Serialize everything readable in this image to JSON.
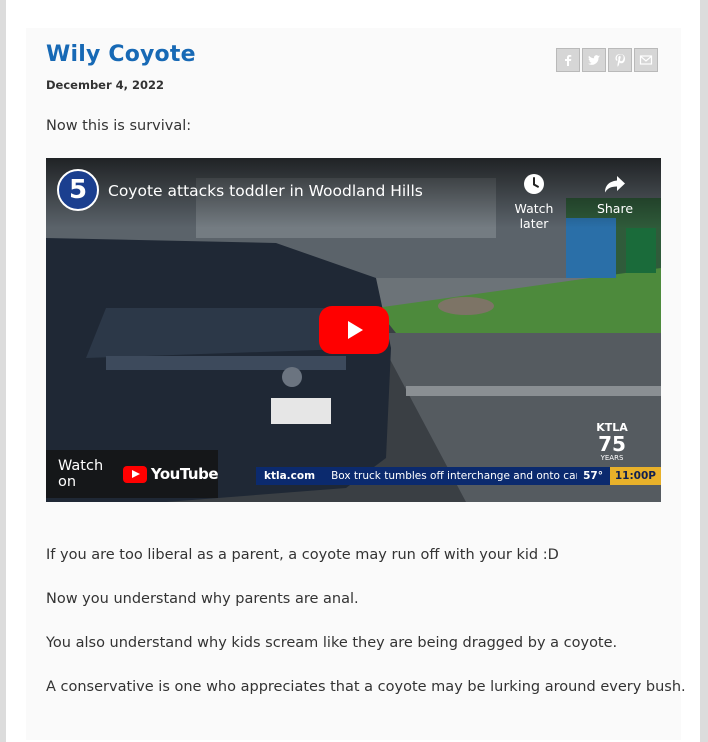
{
  "post": {
    "title": "Wily Coyote",
    "date": "December 4, 2022",
    "intro": "Now this is survival:",
    "paragraphs": [
      "If you are too liberal as a parent, a coyote may run off with your kid :D",
      "Now you understand why parents are anal.",
      "You also understand why kids scream like they are being dragged by a coyote.",
      "A conservative is one who appreciates that a coyote may be lurking around every bush."
    ]
  },
  "share": {
    "icons": [
      "facebook-icon",
      "twitter-icon",
      "pinterest-icon",
      "email-icon"
    ]
  },
  "video": {
    "channel_logo_text": "5",
    "title": "Coyote attacks toddler in Woodland Hills",
    "watch_later_label": "Watch later",
    "share_label": "Share",
    "watch_on_label": "Watch on",
    "youtube_label": "YouTube",
    "ticker_site": "ktla.com",
    "ticker_headline": "Box truck tumbles off interchange and onto cars ne",
    "ticker_temp": "57°",
    "ticker_time": "11:00P",
    "badge_top": "KTLA",
    "badge_number": "75",
    "badge_bottom": "YEARS"
  },
  "colors": {
    "title": "#1769b5",
    "play_button": "#ff0000",
    "ticker": "#0b2a6e"
  }
}
